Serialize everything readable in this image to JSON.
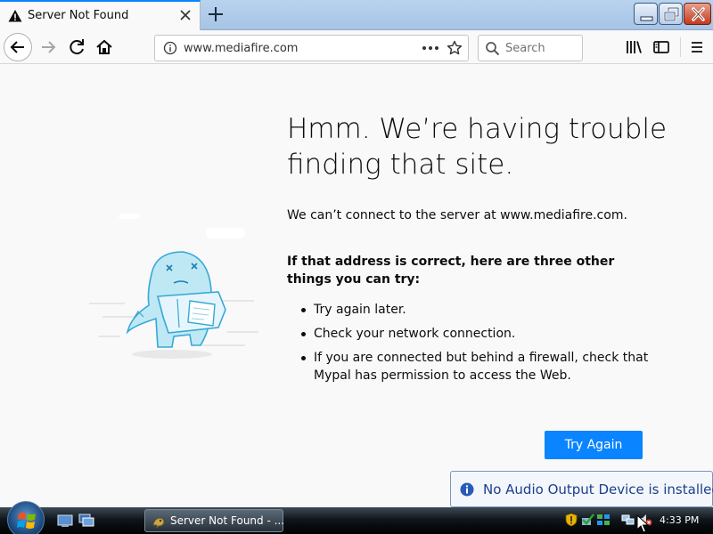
{
  "tab": {
    "title": "Server Not Found"
  },
  "urlbar": {
    "url": "www.mediafire.com"
  },
  "search": {
    "placeholder": "Search"
  },
  "error": {
    "title": "Hmm. We’re having trouble finding that site.",
    "description": "We can’t connect to the server at www.mediafire.com.",
    "hint": "If that address is correct, here are three other things you can try:",
    "suggestions": [
      "Try again later.",
      "Check your network connection.",
      "If you are connected but behind a firewall, check that Mypal has permission to access the Web."
    ],
    "button": "Try Again"
  },
  "notification": {
    "message": "No Audio Output Device is installed."
  },
  "taskbar": {
    "window_title": "Server Not Found - ...",
    "clock": "4:33 PM"
  },
  "colors": {
    "accent": "#0a84ff",
    "close_button": "#c23b1d"
  }
}
